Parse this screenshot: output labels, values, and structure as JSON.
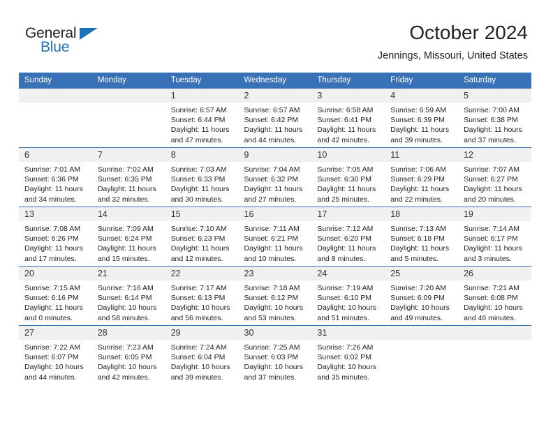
{
  "brand": {
    "name_top": "General",
    "name_bottom": "Blue",
    "accent_color": "#1b72b8",
    "flag_icon": "triangle-flag-icon"
  },
  "header": {
    "title": "October 2024",
    "subtitle": "Jennings, Missouri, United States",
    "header_bg_color": "#3871b5",
    "daynum_bg_color": "#f0f0f0"
  },
  "weekday_headers": [
    "Sunday",
    "Monday",
    "Tuesday",
    "Wednesday",
    "Thursday",
    "Friday",
    "Saturday"
  ],
  "weeks": [
    [
      {
        "day": "",
        "empty": true,
        "sunrise": "",
        "sunset": "",
        "daylight1": "",
        "daylight2": ""
      },
      {
        "day": "",
        "empty": true,
        "sunrise": "",
        "sunset": "",
        "daylight1": "",
        "daylight2": ""
      },
      {
        "day": "1",
        "empty": false,
        "sunrise": "Sunrise: 6:57 AM",
        "sunset": "Sunset: 6:44 PM",
        "daylight1": "Daylight: 11 hours",
        "daylight2": "and 47 minutes."
      },
      {
        "day": "2",
        "empty": false,
        "sunrise": "Sunrise: 6:57 AM",
        "sunset": "Sunset: 6:42 PM",
        "daylight1": "Daylight: 11 hours",
        "daylight2": "and 44 minutes."
      },
      {
        "day": "3",
        "empty": false,
        "sunrise": "Sunrise: 6:58 AM",
        "sunset": "Sunset: 6:41 PM",
        "daylight1": "Daylight: 11 hours",
        "daylight2": "and 42 minutes."
      },
      {
        "day": "4",
        "empty": false,
        "sunrise": "Sunrise: 6:59 AM",
        "sunset": "Sunset: 6:39 PM",
        "daylight1": "Daylight: 11 hours",
        "daylight2": "and 39 minutes."
      },
      {
        "day": "5",
        "empty": false,
        "sunrise": "Sunrise: 7:00 AM",
        "sunset": "Sunset: 6:38 PM",
        "daylight1": "Daylight: 11 hours",
        "daylight2": "and 37 minutes."
      }
    ],
    [
      {
        "day": "6",
        "empty": false,
        "sunrise": "Sunrise: 7:01 AM",
        "sunset": "Sunset: 6:36 PM",
        "daylight1": "Daylight: 11 hours",
        "daylight2": "and 34 minutes."
      },
      {
        "day": "7",
        "empty": false,
        "sunrise": "Sunrise: 7:02 AM",
        "sunset": "Sunset: 6:35 PM",
        "daylight1": "Daylight: 11 hours",
        "daylight2": "and 32 minutes."
      },
      {
        "day": "8",
        "empty": false,
        "sunrise": "Sunrise: 7:03 AM",
        "sunset": "Sunset: 6:33 PM",
        "daylight1": "Daylight: 11 hours",
        "daylight2": "and 30 minutes."
      },
      {
        "day": "9",
        "empty": false,
        "sunrise": "Sunrise: 7:04 AM",
        "sunset": "Sunset: 6:32 PM",
        "daylight1": "Daylight: 11 hours",
        "daylight2": "and 27 minutes."
      },
      {
        "day": "10",
        "empty": false,
        "sunrise": "Sunrise: 7:05 AM",
        "sunset": "Sunset: 6:30 PM",
        "daylight1": "Daylight: 11 hours",
        "daylight2": "and 25 minutes."
      },
      {
        "day": "11",
        "empty": false,
        "sunrise": "Sunrise: 7:06 AM",
        "sunset": "Sunset: 6:29 PM",
        "daylight1": "Daylight: 11 hours",
        "daylight2": "and 22 minutes."
      },
      {
        "day": "12",
        "empty": false,
        "sunrise": "Sunrise: 7:07 AM",
        "sunset": "Sunset: 6:27 PM",
        "daylight1": "Daylight: 11 hours",
        "daylight2": "and 20 minutes."
      }
    ],
    [
      {
        "day": "13",
        "empty": false,
        "sunrise": "Sunrise: 7:08 AM",
        "sunset": "Sunset: 6:26 PM",
        "daylight1": "Daylight: 11 hours",
        "daylight2": "and 17 minutes."
      },
      {
        "day": "14",
        "empty": false,
        "sunrise": "Sunrise: 7:09 AM",
        "sunset": "Sunset: 6:24 PM",
        "daylight1": "Daylight: 11 hours",
        "daylight2": "and 15 minutes."
      },
      {
        "day": "15",
        "empty": false,
        "sunrise": "Sunrise: 7:10 AM",
        "sunset": "Sunset: 6:23 PM",
        "daylight1": "Daylight: 11 hours",
        "daylight2": "and 12 minutes."
      },
      {
        "day": "16",
        "empty": false,
        "sunrise": "Sunrise: 7:11 AM",
        "sunset": "Sunset: 6:21 PM",
        "daylight1": "Daylight: 11 hours",
        "daylight2": "and 10 minutes."
      },
      {
        "day": "17",
        "empty": false,
        "sunrise": "Sunrise: 7:12 AM",
        "sunset": "Sunset: 6:20 PM",
        "daylight1": "Daylight: 11 hours",
        "daylight2": "and 8 minutes."
      },
      {
        "day": "18",
        "empty": false,
        "sunrise": "Sunrise: 7:13 AM",
        "sunset": "Sunset: 6:18 PM",
        "daylight1": "Daylight: 11 hours",
        "daylight2": "and 5 minutes."
      },
      {
        "day": "19",
        "empty": false,
        "sunrise": "Sunrise: 7:14 AM",
        "sunset": "Sunset: 6:17 PM",
        "daylight1": "Daylight: 11 hours",
        "daylight2": "and 3 minutes."
      }
    ],
    [
      {
        "day": "20",
        "empty": false,
        "sunrise": "Sunrise: 7:15 AM",
        "sunset": "Sunset: 6:16 PM",
        "daylight1": "Daylight: 11 hours",
        "daylight2": "and 0 minutes."
      },
      {
        "day": "21",
        "empty": false,
        "sunrise": "Sunrise: 7:16 AM",
        "sunset": "Sunset: 6:14 PM",
        "daylight1": "Daylight: 10 hours",
        "daylight2": "and 58 minutes."
      },
      {
        "day": "22",
        "empty": false,
        "sunrise": "Sunrise: 7:17 AM",
        "sunset": "Sunset: 6:13 PM",
        "daylight1": "Daylight: 10 hours",
        "daylight2": "and 56 minutes."
      },
      {
        "day": "23",
        "empty": false,
        "sunrise": "Sunrise: 7:18 AM",
        "sunset": "Sunset: 6:12 PM",
        "daylight1": "Daylight: 10 hours",
        "daylight2": "and 53 minutes."
      },
      {
        "day": "24",
        "empty": false,
        "sunrise": "Sunrise: 7:19 AM",
        "sunset": "Sunset: 6:10 PM",
        "daylight1": "Daylight: 10 hours",
        "daylight2": "and 51 minutes."
      },
      {
        "day": "25",
        "empty": false,
        "sunrise": "Sunrise: 7:20 AM",
        "sunset": "Sunset: 6:09 PM",
        "daylight1": "Daylight: 10 hours",
        "daylight2": "and 49 minutes."
      },
      {
        "day": "26",
        "empty": false,
        "sunrise": "Sunrise: 7:21 AM",
        "sunset": "Sunset: 6:08 PM",
        "daylight1": "Daylight: 10 hours",
        "daylight2": "and 46 minutes."
      }
    ],
    [
      {
        "day": "27",
        "empty": false,
        "sunrise": "Sunrise: 7:22 AM",
        "sunset": "Sunset: 6:07 PM",
        "daylight1": "Daylight: 10 hours",
        "daylight2": "and 44 minutes."
      },
      {
        "day": "28",
        "empty": false,
        "sunrise": "Sunrise: 7:23 AM",
        "sunset": "Sunset: 6:05 PM",
        "daylight1": "Daylight: 10 hours",
        "daylight2": "and 42 minutes."
      },
      {
        "day": "29",
        "empty": false,
        "sunrise": "Sunrise: 7:24 AM",
        "sunset": "Sunset: 6:04 PM",
        "daylight1": "Daylight: 10 hours",
        "daylight2": "and 39 minutes."
      },
      {
        "day": "30",
        "empty": false,
        "sunrise": "Sunrise: 7:25 AM",
        "sunset": "Sunset: 6:03 PM",
        "daylight1": "Daylight: 10 hours",
        "daylight2": "and 37 minutes."
      },
      {
        "day": "31",
        "empty": false,
        "sunrise": "Sunrise: 7:26 AM",
        "sunset": "Sunset: 6:02 PM",
        "daylight1": "Daylight: 10 hours",
        "daylight2": "and 35 minutes."
      },
      {
        "day": "",
        "empty": true,
        "sunrise": "",
        "sunset": "",
        "daylight1": "",
        "daylight2": ""
      },
      {
        "day": "",
        "empty": true,
        "sunrise": "",
        "sunset": "",
        "daylight1": "",
        "daylight2": ""
      }
    ]
  ]
}
